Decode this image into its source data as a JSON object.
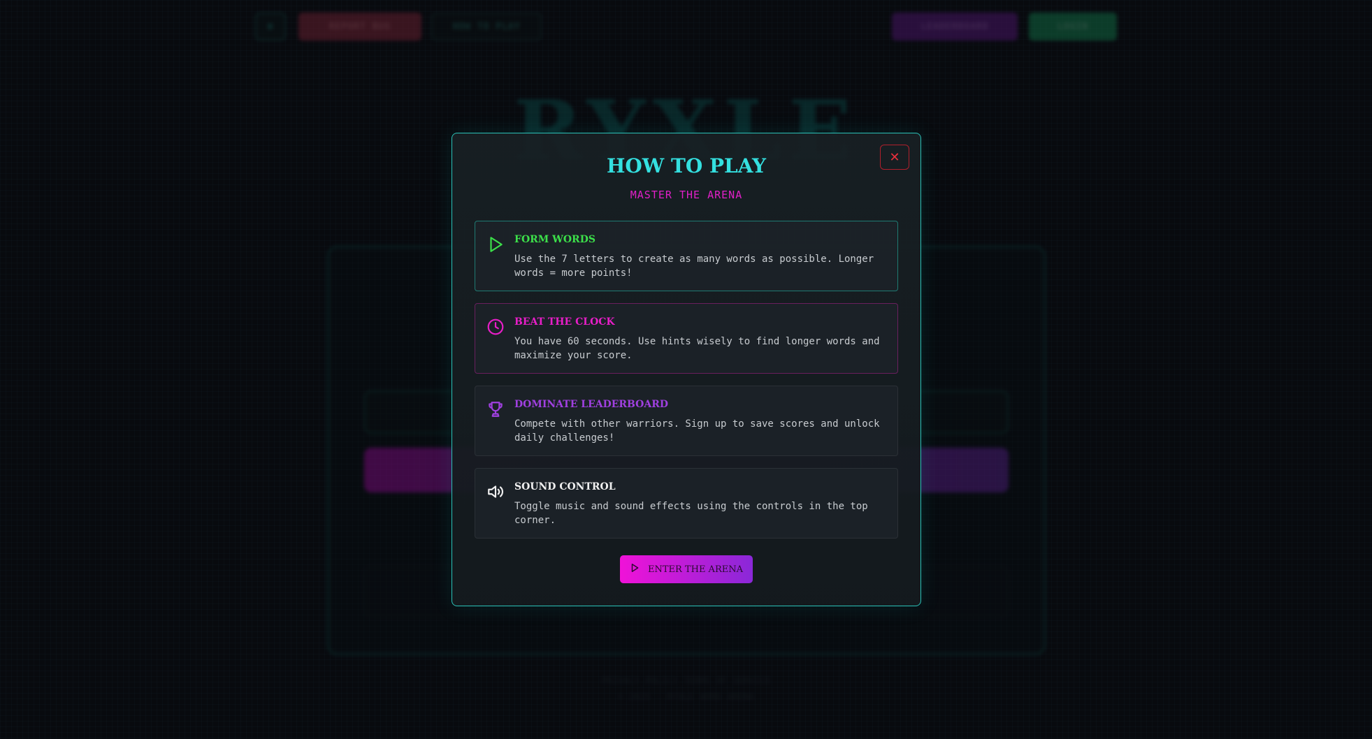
{
  "background": {
    "topbar": {
      "menu_label": "≡",
      "report_label": "REPORT BUG",
      "howto_label": "HOW TO PLAY",
      "leaderboard_label": "LEADERBOARD",
      "login_label": "LOGIN"
    },
    "logo": "RYXLE",
    "footer_line1": "PRIVACY POLICY     TERMS OF SERVICE",
    "footer_line2": "© 2025 · RYXLE WORD ARENA"
  },
  "modal": {
    "title": "HOW TO PLAY",
    "subtitle": "MASTER THE ARENA",
    "close_label": "✕",
    "rules": [
      {
        "icon": "play-icon",
        "title": "FORM WORDS",
        "text": "Use the 7 letters to create as many words as possible. Longer words = more points!",
        "color": "#3ce04a"
      },
      {
        "icon": "clock-icon",
        "title": "BEAT THE CLOCK",
        "text": "You have 60 seconds. Use hints wisely to find longer words and maximize your score.",
        "color": "#e81ec8"
      },
      {
        "icon": "trophy-icon",
        "title": "DOMINATE LEADERBOARD",
        "text": "Compete with other warriors. Sign up to save scores and unlock daily challenges!",
        "color": "#a040e0"
      },
      {
        "icon": "speaker-icon",
        "title": "SOUND CONTROL",
        "text": "Toggle music and sound effects using the controls in the top corner.",
        "color": "#f0f0f0"
      }
    ],
    "enter_label": "ENTER THE ARENA"
  }
}
